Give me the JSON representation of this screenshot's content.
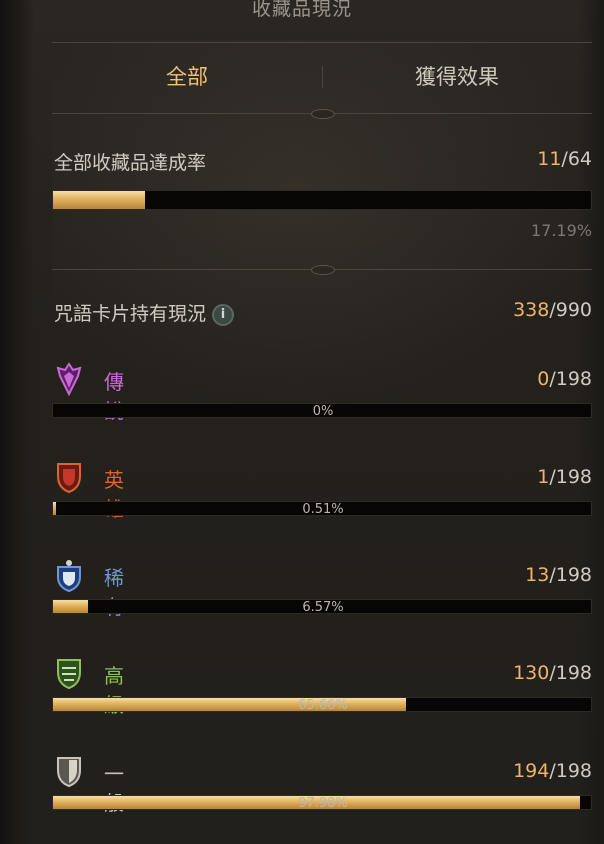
{
  "title": "收藏品現況",
  "tabs": [
    {
      "label": "全部",
      "active": true
    },
    {
      "label": "獲得效果",
      "active": false
    }
  ],
  "collection": {
    "label": "全部收藏品達成率",
    "current": "11",
    "total": "/64",
    "percent_text": "17.19%",
    "fraction": 0.1719
  },
  "spellcards": {
    "label": "咒語卡片持有現況",
    "info_icon": "i",
    "current": "338",
    "total": "/990"
  },
  "rarities": [
    {
      "name": "傳說",
      "current": "0",
      "total": "/198",
      "percent_text": "0%",
      "fraction": 0.0,
      "color": "#c96ad8",
      "icon": "legendary-crown-icon"
    },
    {
      "name": "英雄",
      "current": "1",
      "total": "/198",
      "percent_text": "0.51%",
      "fraction": 0.0051,
      "color": "#e0632f",
      "icon": "hero-shield-icon"
    },
    {
      "name": "稀有",
      "current": "13",
      "total": "/198",
      "percent_text": "6.57%",
      "fraction": 0.0657,
      "color": "#6e96d8",
      "icon": "rare-shield-icon"
    },
    {
      "name": "高級",
      "current": "130",
      "total": "/198",
      "percent_text": "65.66%",
      "fraction": 0.6566,
      "color": "#8fbf56",
      "icon": "advanced-shield-icon"
    },
    {
      "name": "一般",
      "current": "194",
      "total": "/198",
      "percent_text": "97.98%",
      "fraction": 0.9798,
      "color": "#c9c3ba",
      "icon": "common-shield-icon"
    }
  ]
}
